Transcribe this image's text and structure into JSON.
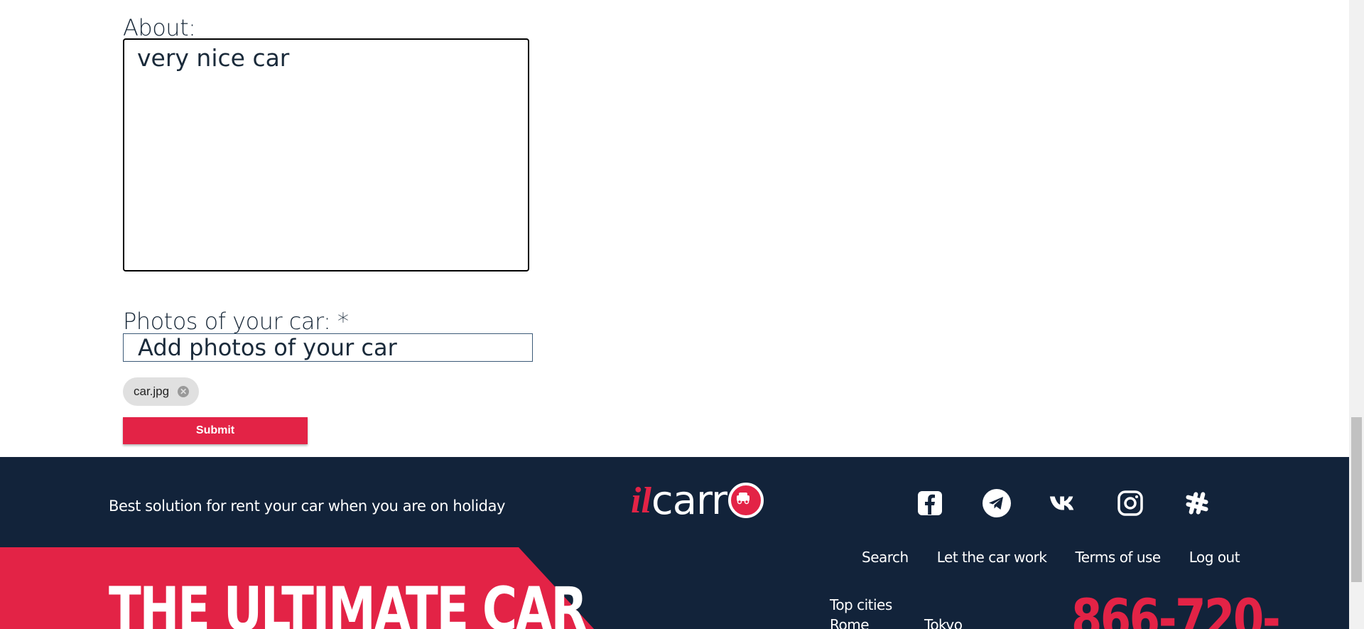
{
  "form": {
    "about_label": "About:",
    "about_value": "very nice car",
    "photos_label": "Photos of your car: *",
    "photos_placeholder": "Add photos of your car",
    "file_chip": "car.jpg",
    "submit_label": "Submit"
  },
  "footer": {
    "tagline": "Best solution for rent your car when you are on holiday",
    "logo_prefix": "il",
    "logo_text": "carr",
    "socials": [
      "facebook-icon",
      "telegram-icon",
      "vk-icon",
      "instagram-icon",
      "slack-icon"
    ],
    "nav": [
      "Search",
      "Let the car work",
      "Terms of use",
      "Log out"
    ],
    "banner_text": "THE ULTIMATE CAR",
    "top_cities_label": "Top cities",
    "cities": [
      "Rome",
      "Tokyo"
    ],
    "phone": "866-720-"
  },
  "colors": {
    "accent": "#e32346",
    "footer_bg": "#12233a"
  }
}
